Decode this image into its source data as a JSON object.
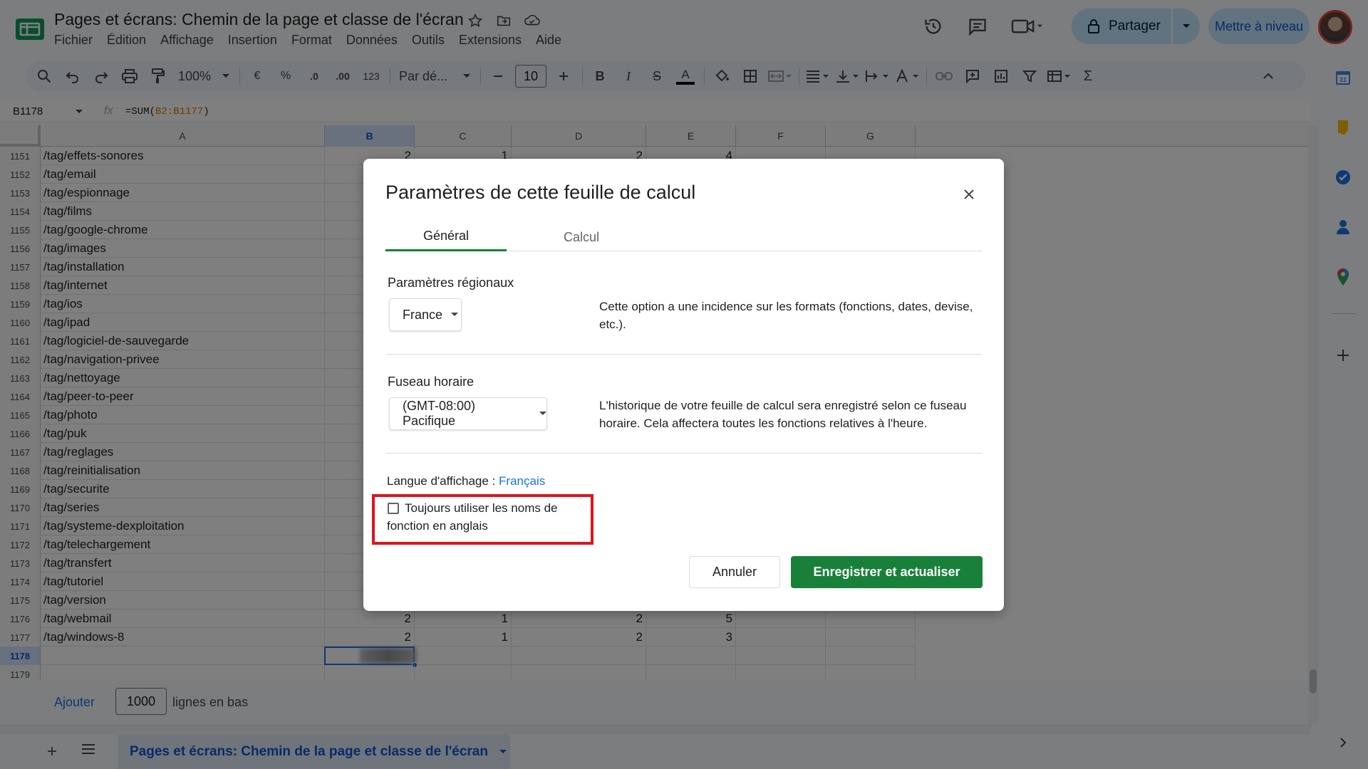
{
  "app": {
    "doc_title": "Pages et écrans: Chemin de la page et classe de l'écran",
    "menu": [
      "Fichier",
      "Édition",
      "Affichage",
      "Insertion",
      "Format",
      "Données",
      "Outils",
      "Extensions",
      "Aide"
    ],
    "share_label": "Partager",
    "upgrade_label": "Mettre à niveau"
  },
  "toolbar": {
    "zoom": "100%",
    "currency": "€",
    "percent": "%",
    "decimal_decrease": ".0",
    "decimal_increase": ".00",
    "number_format": "123",
    "font_family": "Par dé...",
    "font_size": "10",
    "bold": "B",
    "italic": "I",
    "strike": "S",
    "text_color": "A",
    "sigma": "Σ"
  },
  "formula_bar": {
    "cell_ref": "B1178",
    "fx": "fx",
    "formula_prefix": "=SUM(",
    "formula_ref": "B2:B1177",
    "formula_suffix": ")"
  },
  "grid": {
    "columns": [
      "A",
      "B",
      "C",
      "D",
      "E",
      "F",
      "G"
    ],
    "active_column": "B",
    "rows": [
      {
        "n": "1151",
        "a": "/tag/effets-sonores",
        "b": "2",
        "c": "1",
        "d": "2",
        "e": "4"
      },
      {
        "n": "1152",
        "a": "/tag/email",
        "b": "",
        "c": "",
        "d": "",
        "e": ""
      },
      {
        "n": "1153",
        "a": "/tag/espionnage",
        "b": "",
        "c": "",
        "d": "",
        "e": ""
      },
      {
        "n": "1154",
        "a": "/tag/films",
        "b": "",
        "c": "",
        "d": "",
        "e": ""
      },
      {
        "n": "1155",
        "a": "/tag/google-chrome",
        "b": "",
        "c": "",
        "d": "",
        "e": ""
      },
      {
        "n": "1156",
        "a": "/tag/images",
        "b": "",
        "c": "",
        "d": "",
        "e": ""
      },
      {
        "n": "1157",
        "a": "/tag/installation",
        "b": "",
        "c": "",
        "d": "",
        "e": ""
      },
      {
        "n": "1158",
        "a": "/tag/internet",
        "b": "",
        "c": "",
        "d": "",
        "e": ""
      },
      {
        "n": "1159",
        "a": "/tag/ios",
        "b": "",
        "c": "",
        "d": "",
        "e": ""
      },
      {
        "n": "1160",
        "a": "/tag/ipad",
        "b": "",
        "c": "",
        "d": "",
        "e": ""
      },
      {
        "n": "1161",
        "a": "/tag/logiciel-de-sauvegarde",
        "b": "",
        "c": "",
        "d": "",
        "e": ""
      },
      {
        "n": "1162",
        "a": "/tag/navigation-privee",
        "b": "",
        "c": "",
        "d": "",
        "e": ""
      },
      {
        "n": "1163",
        "a": "/tag/nettoyage",
        "b": "",
        "c": "",
        "d": "",
        "e": ""
      },
      {
        "n": "1164",
        "a": "/tag/peer-to-peer",
        "b": "",
        "c": "",
        "d": "",
        "e": ""
      },
      {
        "n": "1165",
        "a": "/tag/photo",
        "b": "",
        "c": "",
        "d": "",
        "e": ""
      },
      {
        "n": "1166",
        "a": "/tag/puk",
        "b": "",
        "c": "",
        "d": "",
        "e": ""
      },
      {
        "n": "1167",
        "a": "/tag/reglages",
        "b": "",
        "c": "",
        "d": "",
        "e": ""
      },
      {
        "n": "1168",
        "a": "/tag/reinitialisation",
        "b": "",
        "c": "",
        "d": "",
        "e": ""
      },
      {
        "n": "1169",
        "a": "/tag/securite",
        "b": "",
        "c": "",
        "d": "",
        "e": ""
      },
      {
        "n": "1170",
        "a": "/tag/series",
        "b": "",
        "c": "",
        "d": "",
        "e": ""
      },
      {
        "n": "1171",
        "a": "/tag/systeme-dexploitation",
        "b": "",
        "c": "",
        "d": "",
        "e": ""
      },
      {
        "n": "1172",
        "a": "/tag/telechargement",
        "b": "",
        "c": "",
        "d": "",
        "e": ""
      },
      {
        "n": "1173",
        "a": "/tag/transfert",
        "b": "",
        "c": "",
        "d": "",
        "e": ""
      },
      {
        "n": "1174",
        "a": "/tag/tutoriel",
        "b": "",
        "c": "",
        "d": "",
        "e": ""
      },
      {
        "n": "1175",
        "a": "/tag/version",
        "b": "",
        "c": "",
        "d": "",
        "e": ""
      },
      {
        "n": "1176",
        "a": "/tag/webmail",
        "b": "2",
        "c": "1",
        "d": "2",
        "e": "5"
      },
      {
        "n": "1177",
        "a": "/tag/windows-8",
        "b": "2",
        "c": "1",
        "d": "2",
        "e": "3"
      },
      {
        "n": "1178",
        "a": "",
        "b": "",
        "c": "",
        "d": "",
        "e": ""
      },
      {
        "n": "1179",
        "a": "",
        "b": "",
        "c": "",
        "d": "",
        "e": ""
      }
    ],
    "active_row": "1178"
  },
  "add_rows": {
    "link": "Ajouter",
    "count": "1000",
    "suffix": "lignes en bas"
  },
  "sheet_tab": {
    "name": "Pages et écrans: Chemin de la page et classe de l'écran"
  },
  "side_panel": {
    "calendar_day": "31"
  },
  "dialog": {
    "title": "Paramètres de cette feuille de calcul",
    "tabs": [
      "Général",
      "Calcul"
    ],
    "active_tab": "Général",
    "locale_label": "Paramètres régionaux",
    "locale_value": "France",
    "locale_desc": "Cette option a une incidence sur les formats (fonctions, dates, devise, etc.).",
    "timezone_label": "Fuseau horaire",
    "timezone_value": "(GMT-08:00) Pacifique",
    "timezone_desc": "L'historique de votre feuille de calcul sera enregistré selon ce fuseau horaire. Cela affectera toutes les fonctions relatives à l'heure.",
    "display_lang_label": "Langue d'affichage :",
    "display_lang_value": "Français",
    "english_functions_label": "Toujours utiliser les noms de fonction en anglais",
    "english_functions_checked": false,
    "cancel_label": "Annuler",
    "save_label": "Enregistrer et actualiser"
  },
  "colors": {
    "accent_green": "#188038",
    "link_blue": "#1a73e8",
    "highlight_red": "#e3131b",
    "share_bg": "#c2e7ff"
  }
}
